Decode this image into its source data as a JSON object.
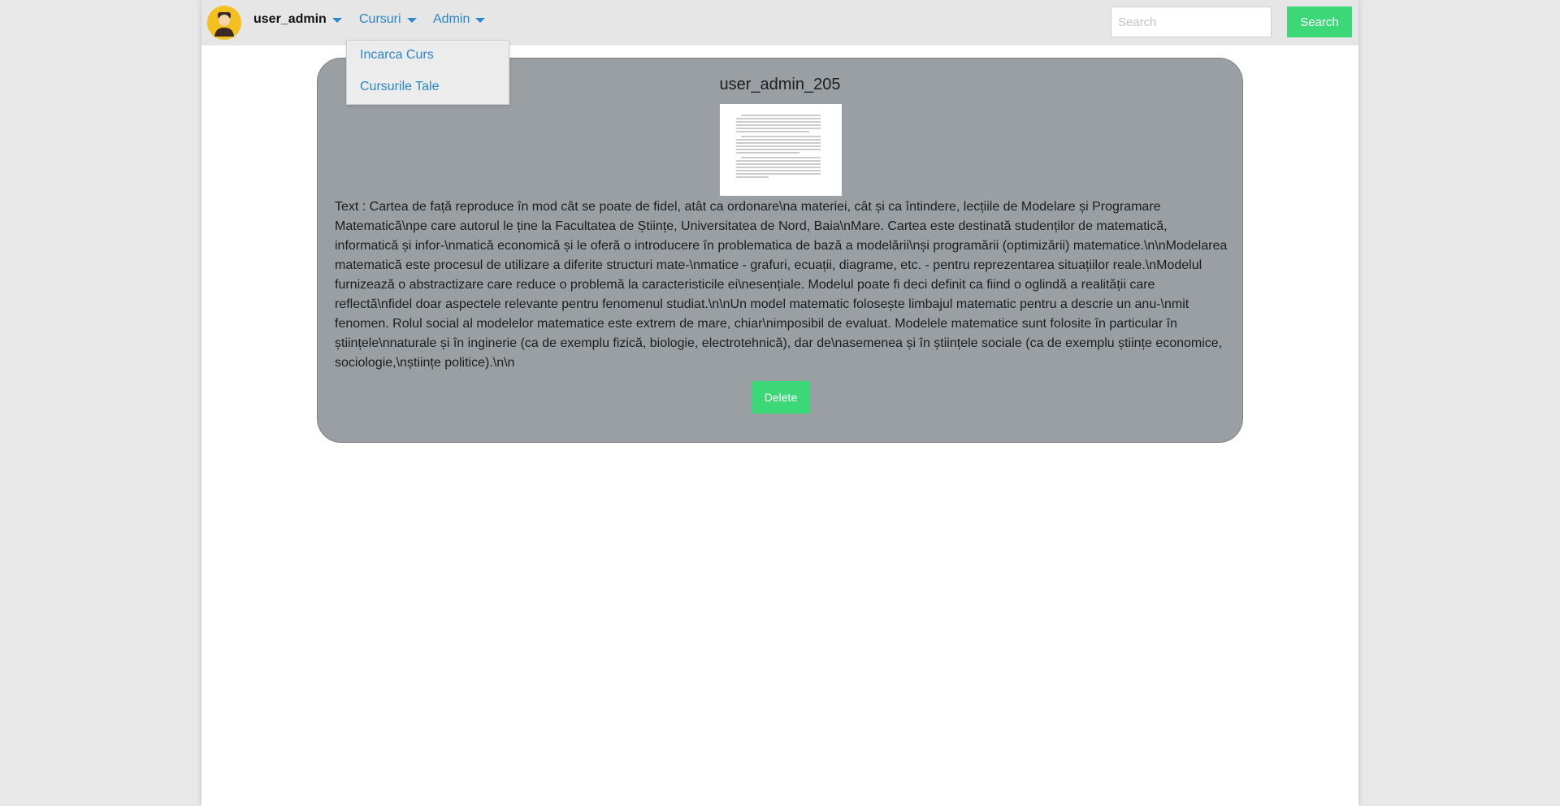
{
  "navbar": {
    "username": "user_admin",
    "menu_cursuri": "Cursuri",
    "menu_admin": "Admin",
    "search_placeholder": "Search",
    "search_button": "Search"
  },
  "dropdown": {
    "items": [
      {
        "label": "Incarca Curs"
      },
      {
        "label": "Cursurile Tale"
      }
    ]
  },
  "card": {
    "title": "user_admin_205",
    "text": "Text : Cartea de față reproduce în mod cât se poate de fidel, atât ca ordonare\\na materiei, cât și ca întindere, lecțiile de Modelare și Programare Matematică\\npe care autorul le ține la Facultatea de Științe, Universitatea de Nord, Baia\\nMare. Cartea este destinată studenților de matematică, informatică și infor-\\nmatică economică și le oferă o introducere în problematica de bază a modelării\\nși programării (optimizării) matematice.\\n\\nModelarea matematică este procesul de utilizare a diferite structuri mate-\\nmatice - grafuri, ecuații, diagrame, etc. - pentru reprezentarea situațiilor reale.\\nModelul furnizează o abstractizare care reduce o problemă la caracteristicile ei\\nesențiale. Modelul poate fi deci definit ca fiind o oglindă a realității care reflectă\\nfidel doar aspectele relevante pentru fenomenul studiat.\\n\\nUn model matematic folosește limbajul matematic pentru a descrie un anu-\\nmit fenomen. Rolul social al modelelor matematice este extrem de mare, chiar\\nimposibil de evaluat. Modelele matematice sunt folosite în particular în științele\\nnaturale și în inginerie (ca de exemplu fizică, biologie, electrotehnică), dar de\\nasemenea și în științele sociale (ca de exemplu științe economice, sociologie,\\nștiințe politice).\\n\\n",
    "delete_button": "Delete"
  },
  "colors": {
    "accent_green": "#3cd878",
    "link_blue": "#2a87c8",
    "card_gray": "#9a9fa3",
    "navbar_gray": "#e6e6e6"
  },
  "icons": {
    "avatar": "user-avatar-icon",
    "caret": "caret-down-icon"
  }
}
